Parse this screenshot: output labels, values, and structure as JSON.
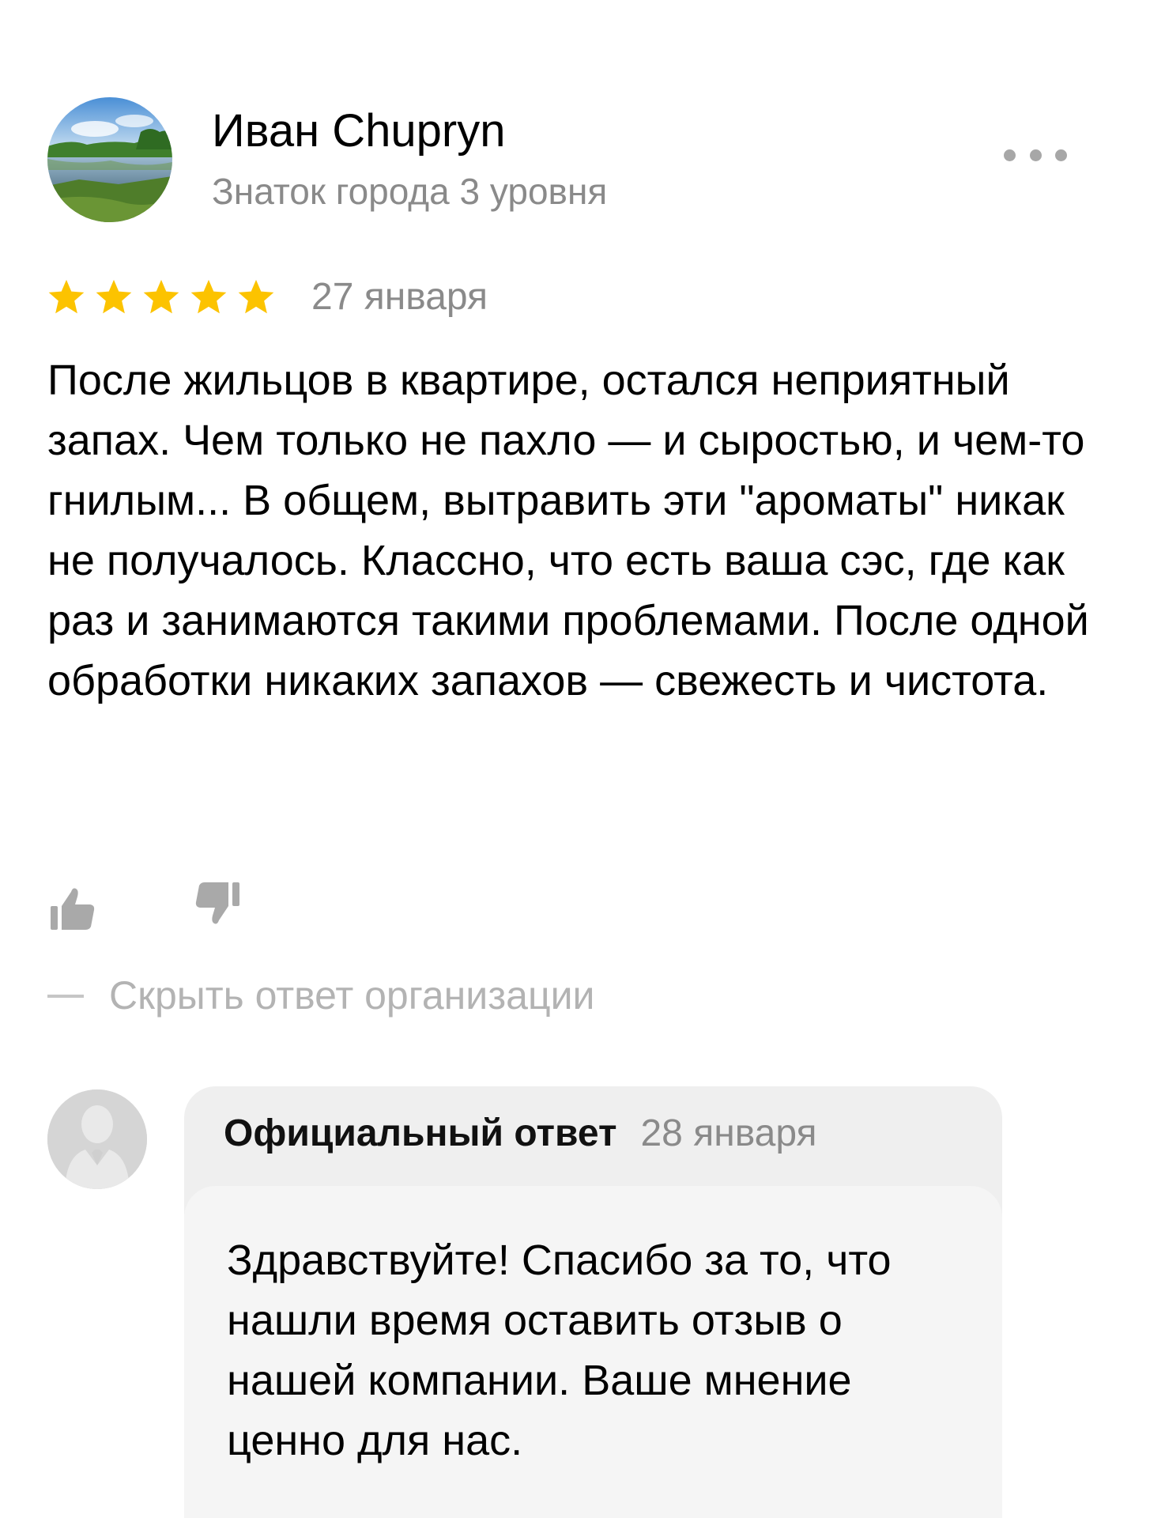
{
  "review": {
    "author": {
      "name": "Иван Chupryn",
      "level": "Знаток города 3 уровня",
      "avatar_icon": "landscape-photo-avatar"
    },
    "more_icon": "more-dots-icon",
    "rating": {
      "stars": 5,
      "max": 5,
      "star_color": "#fcc300"
    },
    "date": "27 января",
    "text": "После жильцов в квартире, остался неприятный запах. Чем только не пахло — и сыростью, и чем-то гнилым... В общем, вытравить эти \"ароматы\" никак не получалось. Классно, что есть ваша сэс, где как раз и занимаются такими проблемами. После одной обработки никаких запахов — свежесть и чистота.",
    "like_icon": "thumbs-up-icon",
    "dislike_icon": "thumbs-down-icon",
    "hide_reply_label": "Скрыть ответ организации"
  },
  "official_reply": {
    "avatar_icon": "person-silhouette-icon",
    "title": "Официальный ответ",
    "date": "28 января",
    "text": "Здравствуйте! Спасибо за то, что нашли время оставить отзыв о нашей компании. Ваше мнение ценно для нас."
  }
}
